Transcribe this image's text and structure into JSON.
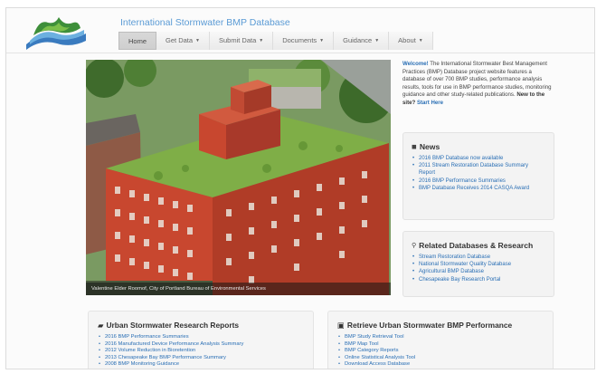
{
  "header": {
    "site_title": "International Stormwater BMP Database"
  },
  "nav": {
    "items": [
      {
        "label": "Home",
        "active": true,
        "dropdown": false
      },
      {
        "label": "Get Data",
        "active": false,
        "dropdown": true
      },
      {
        "label": "Submit Data",
        "active": false,
        "dropdown": true
      },
      {
        "label": "Documents",
        "active": false,
        "dropdown": true
      },
      {
        "label": "Guidance",
        "active": false,
        "dropdown": true
      },
      {
        "label": "About",
        "active": false,
        "dropdown": true
      }
    ]
  },
  "hero": {
    "caption": "Valentine Elder Roomof, City of Portland Bureau of Environmental Services"
  },
  "intro": {
    "welcome": "Welcome!",
    "text": " The International Stormwater Best Management Practices (BMP) Database project website features a database of over 700 BMP studies, performance analysis results, tools for use in BMP performance studies, monitoring guidance and other study-related publications. ",
    "question": "New to the site?",
    "link": "Start Here"
  },
  "news": {
    "title": "News",
    "items": [
      "2016 BMP Database now available",
      "2011 Stream Restoration Database Summary Report",
      "2016 BMP Performance Summaries",
      "BMP Database Receives 2014 CASQA Award"
    ]
  },
  "related": {
    "title": "Related Databases & Research",
    "items": [
      "Stream Restoration Database",
      "National Stormwater Quality Database",
      "Agricultural BMP Database",
      "Chesapeake Bay Research Portal"
    ]
  },
  "reports": {
    "title": "Urban Stormwater Research Reports",
    "items": [
      "2016 BMP Performance Summaries",
      "2016 Manufactured Device Performance Analysis Summary",
      "2012 Volume Reduction in Bioretention",
      "2013 Chesapeake Bay BMP Performance Summary",
      "2008 BMP Monitoring Guidance"
    ]
  },
  "performance": {
    "title": "Retrieve Urban Stormwater BMP Performance",
    "items": [
      "BMP Study Retrieval Tool",
      "BMP Map Tool",
      "BMP Category Reports",
      "Online Statistical Analysis Tool",
      "Download Access Database"
    ]
  },
  "colors": {
    "link": "#2a6fb5",
    "title": "#5b9bd5",
    "brick": "#c8472f",
    "roof": "#6a9e3c"
  }
}
